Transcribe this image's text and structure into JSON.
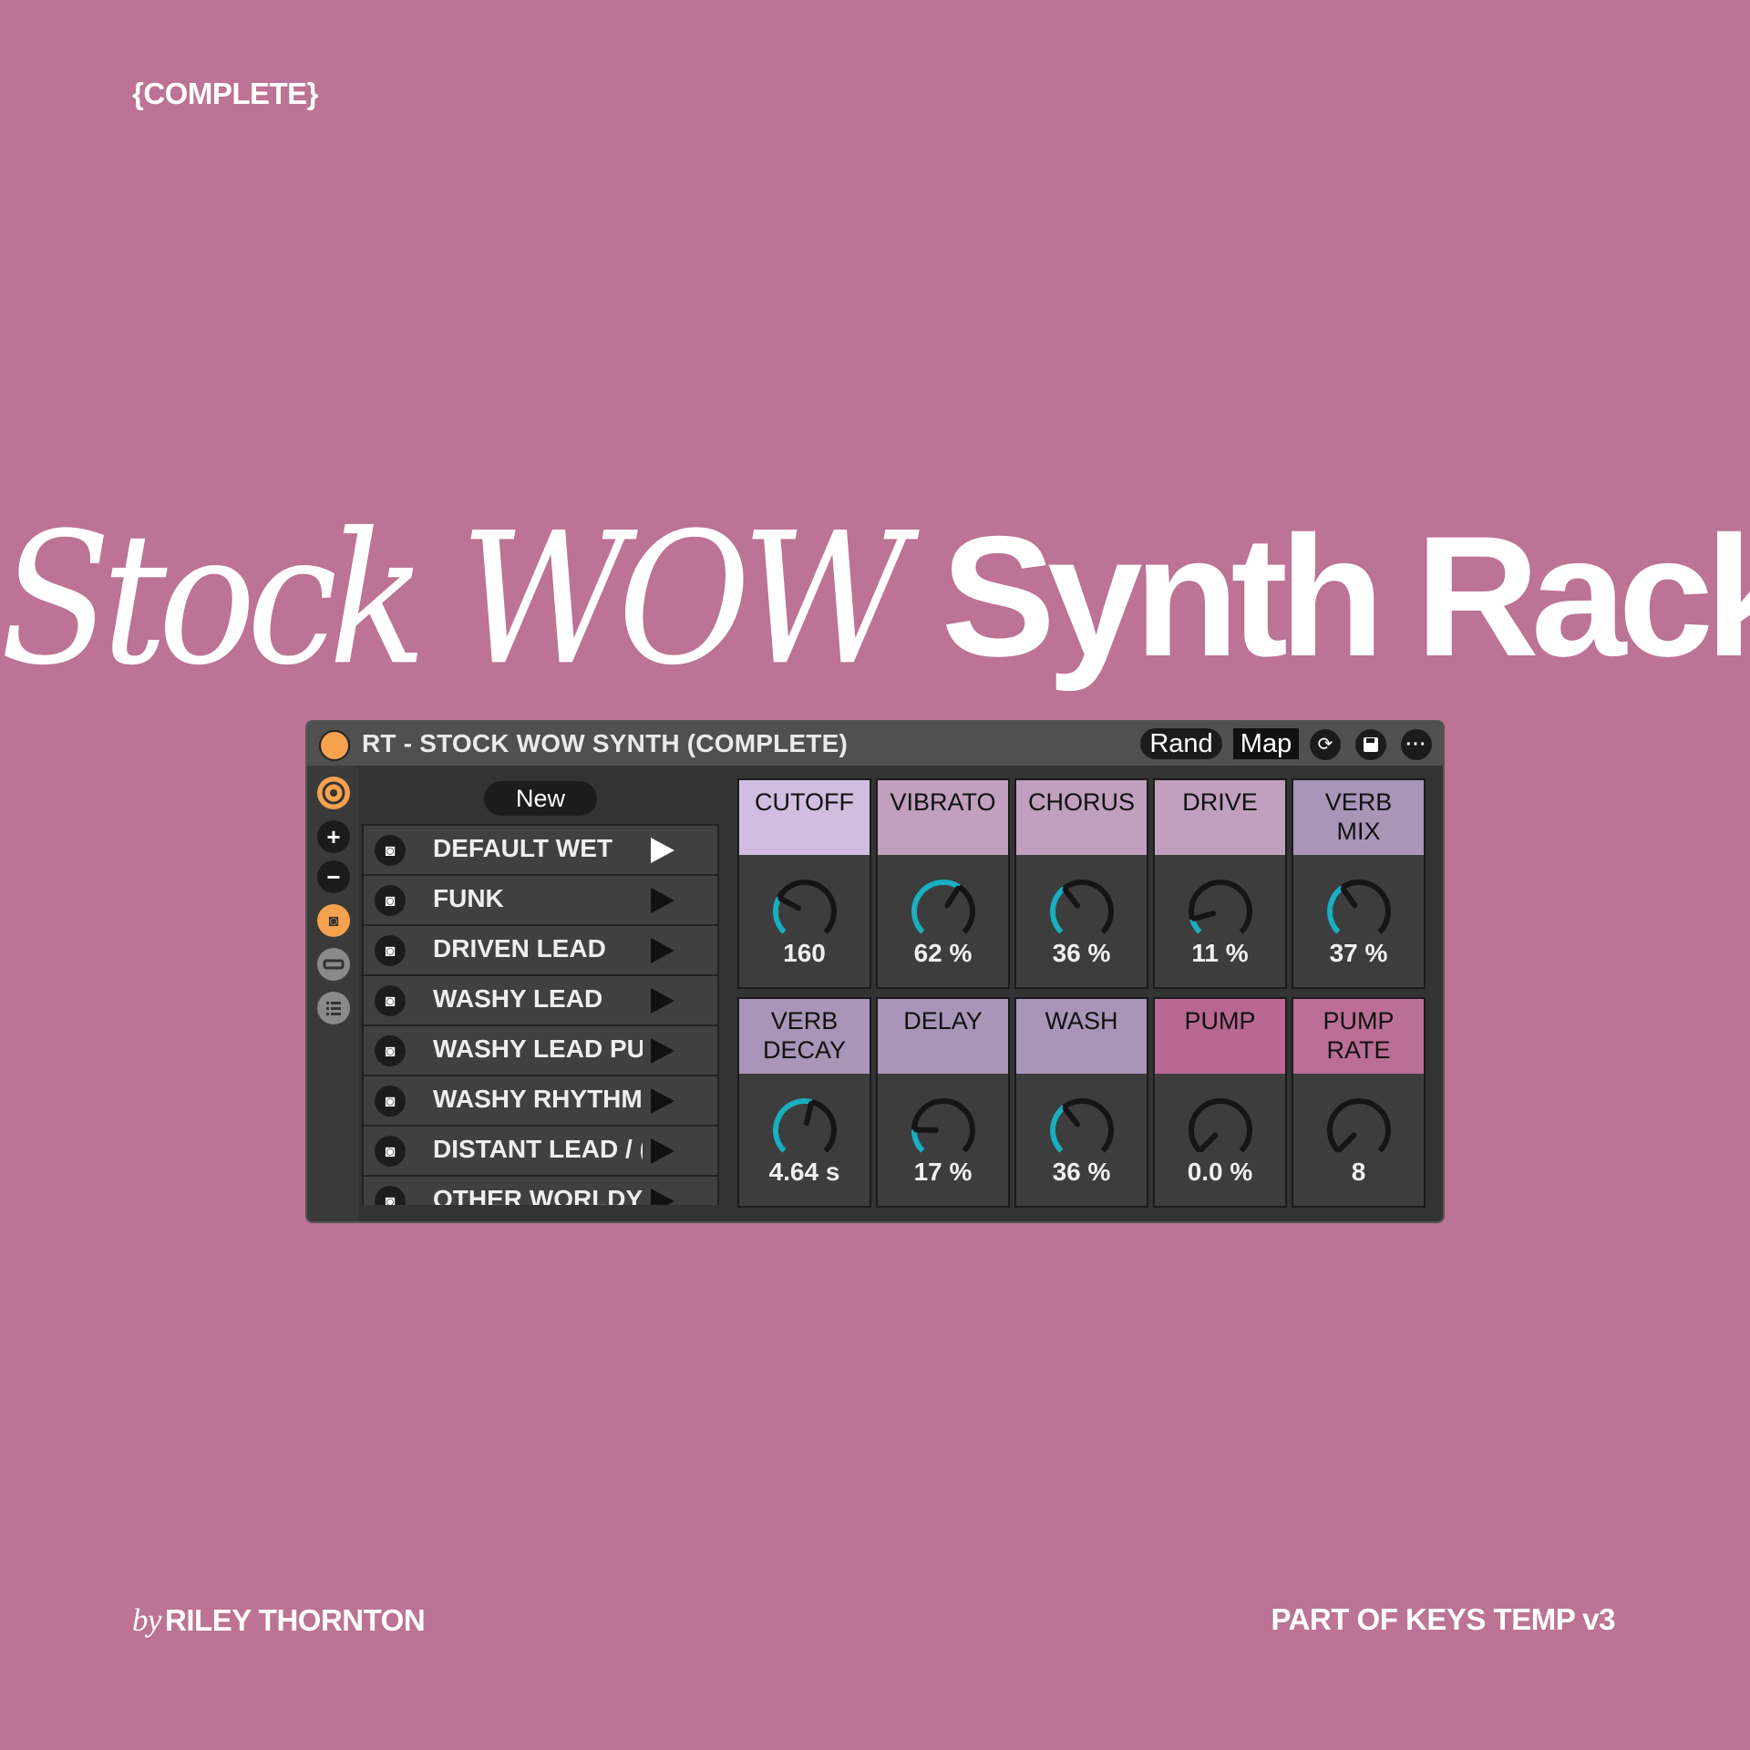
{
  "header": {
    "tag": "{COMPLETE}"
  },
  "title": {
    "serif": "Stock WOW",
    "sans": "Synth Rack"
  },
  "device": {
    "title": "RT - STOCK WOW SYNTH (COMPLETE)",
    "rand_label": "Rand",
    "map_label": "Map",
    "new_label": "New",
    "presets": [
      {
        "name": "DEFAULT WET",
        "active": true
      },
      {
        "name": "FUNK",
        "active": false
      },
      {
        "name": "DRIVEN LEAD",
        "active": false
      },
      {
        "name": "WASHY LEAD",
        "active": false
      },
      {
        "name": "WASHY LEAD PU",
        "active": false
      },
      {
        "name": "WASHY RHYTHM",
        "active": false
      },
      {
        "name": "DISTANT LEAD / (",
        "active": false
      },
      {
        "name": "OTHER WORLDY",
        "active": false
      }
    ],
    "macros": [
      {
        "label": "CUTOFF",
        "value": "160",
        "level": 0.27,
        "color": "#d0bde0"
      },
      {
        "label": "VIBRATO",
        "value": "62 %",
        "level": 0.62,
        "color": "#c09fbf"
      },
      {
        "label": "CHORUS",
        "value": "36 %",
        "level": 0.36,
        "color": "#c09fbf"
      },
      {
        "label": "DRIVE",
        "value": "11 %",
        "level": 0.11,
        "color": "#c09fbf"
      },
      {
        "label": "VERB MIX",
        "value": "37 %",
        "level": 0.37,
        "color": "#a895b8"
      },
      {
        "label": "VERB DECAY",
        "value": "4.64 s",
        "level": 0.55,
        "color": "#a895b8"
      },
      {
        "label": "DELAY",
        "value": "17 %",
        "level": 0.17,
        "color": "#a895b8"
      },
      {
        "label": "WASH",
        "value": "36 %",
        "level": 0.36,
        "color": "#a895b8"
      },
      {
        "label": "PUMP",
        "value": "0.0 %",
        "level": 0.0,
        "color": "#b86891"
      },
      {
        "label": "PUMP RATE",
        "value": "8",
        "level": 0.0,
        "color": "#bb6e96"
      }
    ],
    "colors": {
      "accent": "#1aaec0",
      "power": "#f6a14e"
    }
  },
  "footer": {
    "by": "by",
    "author": "RILEY THORNTON",
    "right": "PART OF KEYS TEMP v3"
  }
}
